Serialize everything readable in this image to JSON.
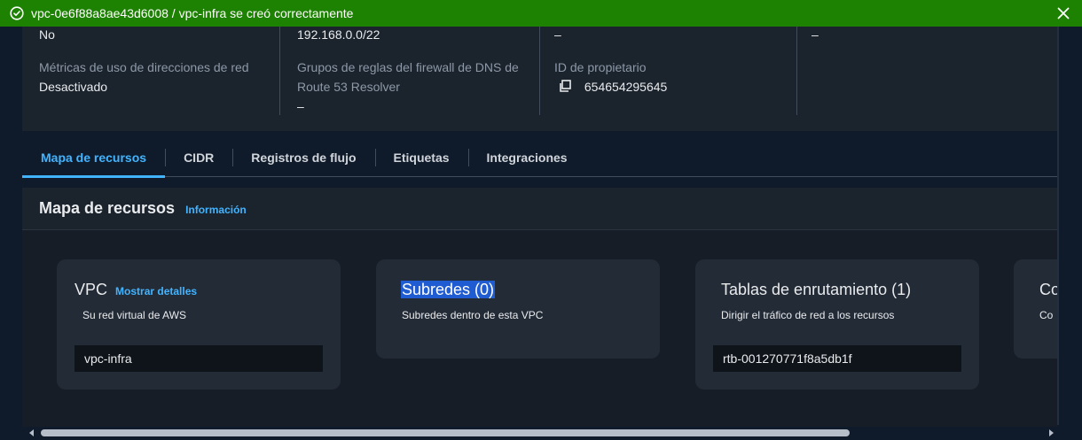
{
  "flash": {
    "message": "vpc-0e6f88a8ae43d6008 / vpc-infra se creó correctamente",
    "icon": "check-circle-icon",
    "close_icon": "close-icon",
    "color": "#1d8102"
  },
  "details": {
    "col1": {
      "top_value": "No",
      "label": "Métricas de uso de direcciones de red",
      "value": "Desactivado"
    },
    "col2": {
      "top_value": "192.168.0.0/22",
      "label_line1": "Grupos de reglas del firewall de DNS de",
      "label_line2": "Route 53 Resolver",
      "value": "–"
    },
    "col3": {
      "top_value": "–",
      "label": "ID de propietario",
      "value": "654654295645",
      "icon": "copy-icon"
    },
    "col4": {
      "top_value": "–"
    }
  },
  "tabs": [
    {
      "label": "Mapa de recursos",
      "active": true
    },
    {
      "label": "CIDR"
    },
    {
      "label": "Registros de flujo"
    },
    {
      "label": "Etiquetas"
    },
    {
      "label": "Integraciones"
    }
  ],
  "resource_map": {
    "title": "Mapa de recursos",
    "info_link": "Información",
    "cards": [
      {
        "title": "VPC",
        "link": "Mostrar detalles",
        "description": "Su red virtual de AWS",
        "item": "vpc-infra"
      },
      {
        "title": "Subredes (0)",
        "description": "Subredes dentro de esta VPC"
      },
      {
        "title": "Tablas de enrutamiento (1)",
        "description": "Dirigir el tráfico de red a los recursos",
        "item": "rtb-001270771f8a5db1f"
      },
      {
        "title": "Co",
        "description": "Co"
      }
    ]
  },
  "colors": {
    "accent": "#42b4ff",
    "background": "#0f1b2a",
    "panel": "#1b232d",
    "card": "#232b37"
  }
}
